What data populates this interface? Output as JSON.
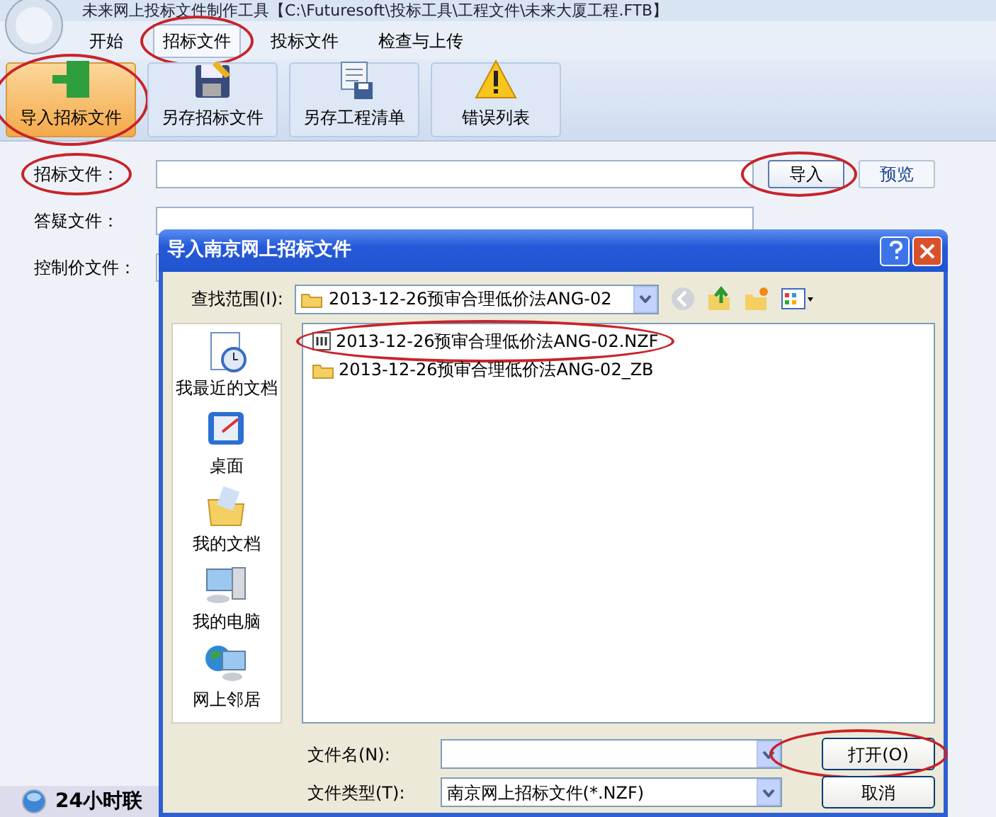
{
  "app": {
    "title": "未来网上投标文件制作工具【C:\\Futuresoft\\投标工具\\工程文件\\未来大厦工程.FTB】"
  },
  "tabs": [
    {
      "label": "开始",
      "selected": false,
      "circled": false
    },
    {
      "label": "招标文件",
      "selected": true,
      "circled": true
    },
    {
      "label": "投标文件",
      "selected": false,
      "circled": false
    },
    {
      "label": "检查与上传",
      "selected": false,
      "circled": false
    }
  ],
  "toolbar": [
    {
      "label": "导入招标文件",
      "kind": "import",
      "selected": true,
      "circled": true
    },
    {
      "label": "另存招标文件",
      "kind": "save",
      "selected": false,
      "circled": false
    },
    {
      "label": "另存工程清单",
      "kind": "scroll",
      "selected": false,
      "circled": false
    },
    {
      "label": "错误列表",
      "kind": "warning",
      "selected": false,
      "circled": false
    }
  ],
  "fields": [
    {
      "label": "招标文件：",
      "circled": true,
      "buttons": [
        {
          "label": "导入",
          "kind": "default",
          "circled": true
        },
        {
          "label": "预览",
          "kind": "link",
          "circled": false
        }
      ]
    },
    {
      "label": "答疑文件：",
      "circled": false
    },
    {
      "label": "控制价文件：",
      "circled": false
    }
  ],
  "footer": {
    "text": "24小时联"
  },
  "dialog": {
    "title": "导入南京网上招标文件",
    "look_in": {
      "label": "查找范围(I):",
      "value": "2013-12-26预审合理低价法ANG-02"
    },
    "places": [
      {
        "label": "我最近的文档",
        "kind": "recent"
      },
      {
        "label": "桌面",
        "kind": "desktop"
      },
      {
        "label": "我的文档",
        "kind": "documents"
      },
      {
        "label": "我的电脑",
        "kind": "computer"
      },
      {
        "label": "网上邻居",
        "kind": "network"
      }
    ],
    "files": [
      {
        "name": "2013-12-26预审合理低价法ANG-02.NZF",
        "kind": "file",
        "circled": true
      },
      {
        "name": "2013-12-26预审合理低价法ANG-02_ZB",
        "kind": "folder",
        "circled": false
      }
    ],
    "file_name": {
      "label": "文件名(N):"
    },
    "file_type": {
      "label": "文件类型(T):",
      "value": "南京网上招标文件(*.NZF)"
    },
    "buttons": [
      {
        "label": "打开(O)",
        "circled": true
      },
      {
        "label": "取消",
        "circled": false
      }
    ]
  }
}
